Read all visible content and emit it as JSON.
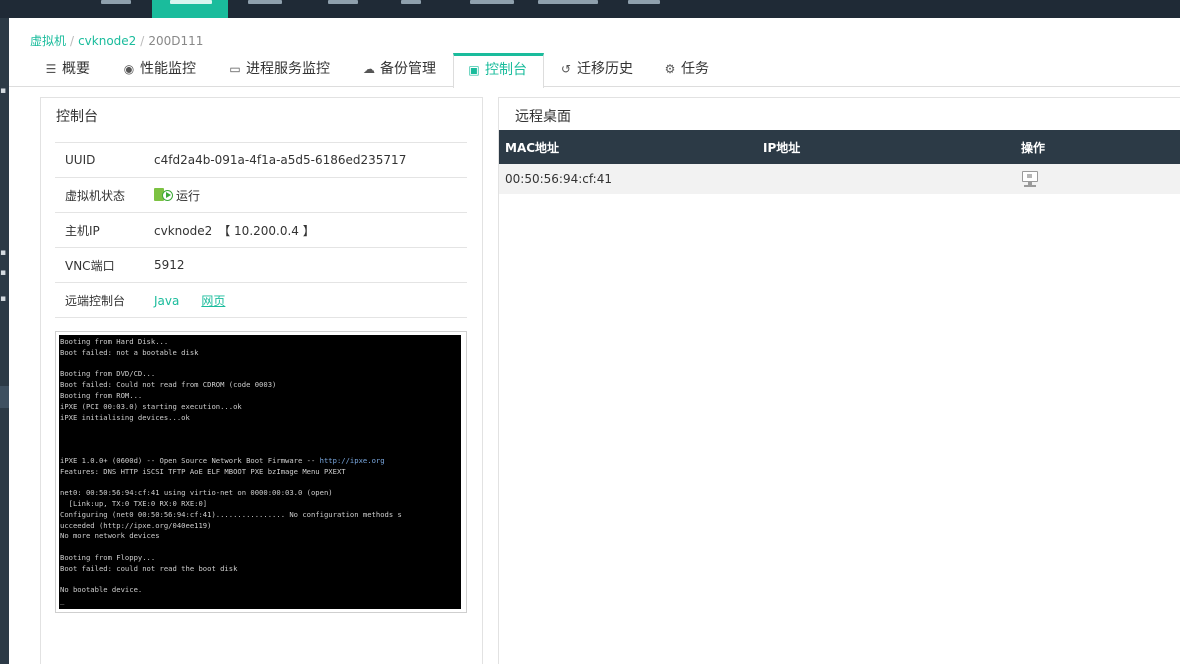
{
  "breadcrumb": {
    "items": [
      "虚拟机",
      "cvknode2"
    ],
    "current": "200D111"
  },
  "tabs": [
    {
      "label": "概要",
      "icon": "list-icon"
    },
    {
      "label": "性能监控",
      "icon": "gauge-icon"
    },
    {
      "label": "进程服务监控",
      "icon": "monitor-icon"
    },
    {
      "label": "备份管理",
      "icon": "cloud-icon"
    },
    {
      "label": "控制台",
      "icon": "console-icon",
      "active": true
    },
    {
      "label": "迁移历史",
      "icon": "history-icon"
    },
    {
      "label": "任务",
      "icon": "gear-icon"
    }
  ],
  "console_panel": {
    "title": "控制台",
    "rows": [
      {
        "key": "UUID",
        "value": "c4fd2a4b-091a-4f1a-a5d5-6186ed235717"
      },
      {
        "key": "虚拟机状态",
        "value": "运行"
      },
      {
        "key": "主机IP",
        "host": "cvknode2",
        "ip": "【 10.200.0.4 】"
      },
      {
        "key": "VNC端口",
        "value": "5912"
      },
      {
        "key": "远端控制台",
        "link_java": "Java",
        "link_web": "网页"
      }
    ],
    "screen_lines": [
      "Booting from Hard Disk...",
      "Boot failed: not a bootable disk",
      "",
      "Booting from DVD/CD...",
      "Boot failed: Could not read from CDROM (code 0003)",
      "Booting from ROM...",
      "iPXE (PCI 00:03.0) starting execution...ok",
      "iPXE initialising devices...ok",
      "",
      "",
      "",
      "iPXE 1.0.0+ (0600d) -- Open Source Network Boot Firmware -- http://ipxe.org",
      "Features: DNS HTTP iSCSI TFTP AoE ELF MBOOT PXE bzImage Menu PXEXT",
      "",
      "net0: 00:50:56:94:cf:41 using virtio-net on 0000:00:03.0 (open)",
      "  [Link:up, TX:0 TXE:0 RX:0 RXE:0]",
      "Configuring (net0 00:50:56:94:cf:41)................ No configuration methods s",
      "ucceeded (http://ipxe.org/040ee119)",
      "No more network devices",
      "",
      "Booting from Floppy...",
      "Boot failed: could not read the boot disk",
      "",
      "No bootable device.",
      "_"
    ]
  },
  "remote_desktop": {
    "title": "远程桌面",
    "columns": [
      "MAC地址",
      "IP地址",
      "操作"
    ],
    "rows": [
      {
        "mac": "00:50:56:94:cf:41",
        "ip": "",
        "action_icon": "desktop-icon"
      }
    ]
  },
  "colors": {
    "accent": "#1abc9c",
    "nav_dark": "#1f2a36",
    "table_header": "#2c3a46"
  }
}
